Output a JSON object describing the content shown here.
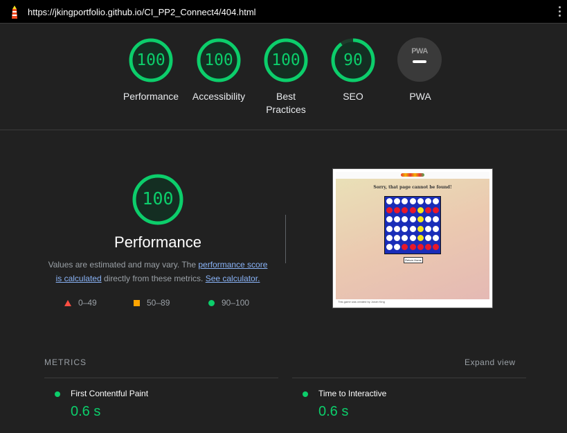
{
  "topbar": {
    "url": "https://jkingportfolio.github.io/CI_PP2_Connect4/404.html",
    "logo_icon": "lighthouse-icon",
    "menu_icon": "more-vertical-icon"
  },
  "colors": {
    "pass": "#0cce6b",
    "average": "#ffa400",
    "fail": "#ff4e42",
    "link": "#8ab4f8"
  },
  "scores": [
    {
      "value": "100",
      "label": "Performance",
      "fraction": 1.0
    },
    {
      "value": "100",
      "label": "Accessibility",
      "fraction": 1.0
    },
    {
      "value": "100",
      "label": "Best Practices",
      "fraction": 1.0
    },
    {
      "value": "90",
      "label": "SEO",
      "fraction": 0.9
    }
  ],
  "pwa": {
    "badge_text": "PWA",
    "label": "PWA"
  },
  "performance": {
    "score": "100",
    "title": "Performance",
    "desc_prefix": "Values are estimated and may vary. The ",
    "desc_link1": "performance score is calculated",
    "desc_mid": " directly from these metrics. ",
    "desc_link2": "See calculator."
  },
  "legend": [
    {
      "range": "0–49",
      "icon": "triangle-icon",
      "color": "#ff4e42"
    },
    {
      "range": "50–89",
      "icon": "square-icon",
      "color": "#ffa400"
    },
    {
      "range": "90–100",
      "icon": "circle-icon",
      "color": "#0cce6b"
    }
  ],
  "screenshot": {
    "message": "Sorry, that page cannot be found!",
    "button": "Return Home",
    "footer": "This game was created by Jonah King"
  },
  "metrics": {
    "heading": "METRICS",
    "expand": "Expand view",
    "items": [
      {
        "title": "First Contentful Paint",
        "value": "0.6 s"
      },
      {
        "title": "Time to Interactive",
        "value": "0.6 s"
      }
    ]
  }
}
